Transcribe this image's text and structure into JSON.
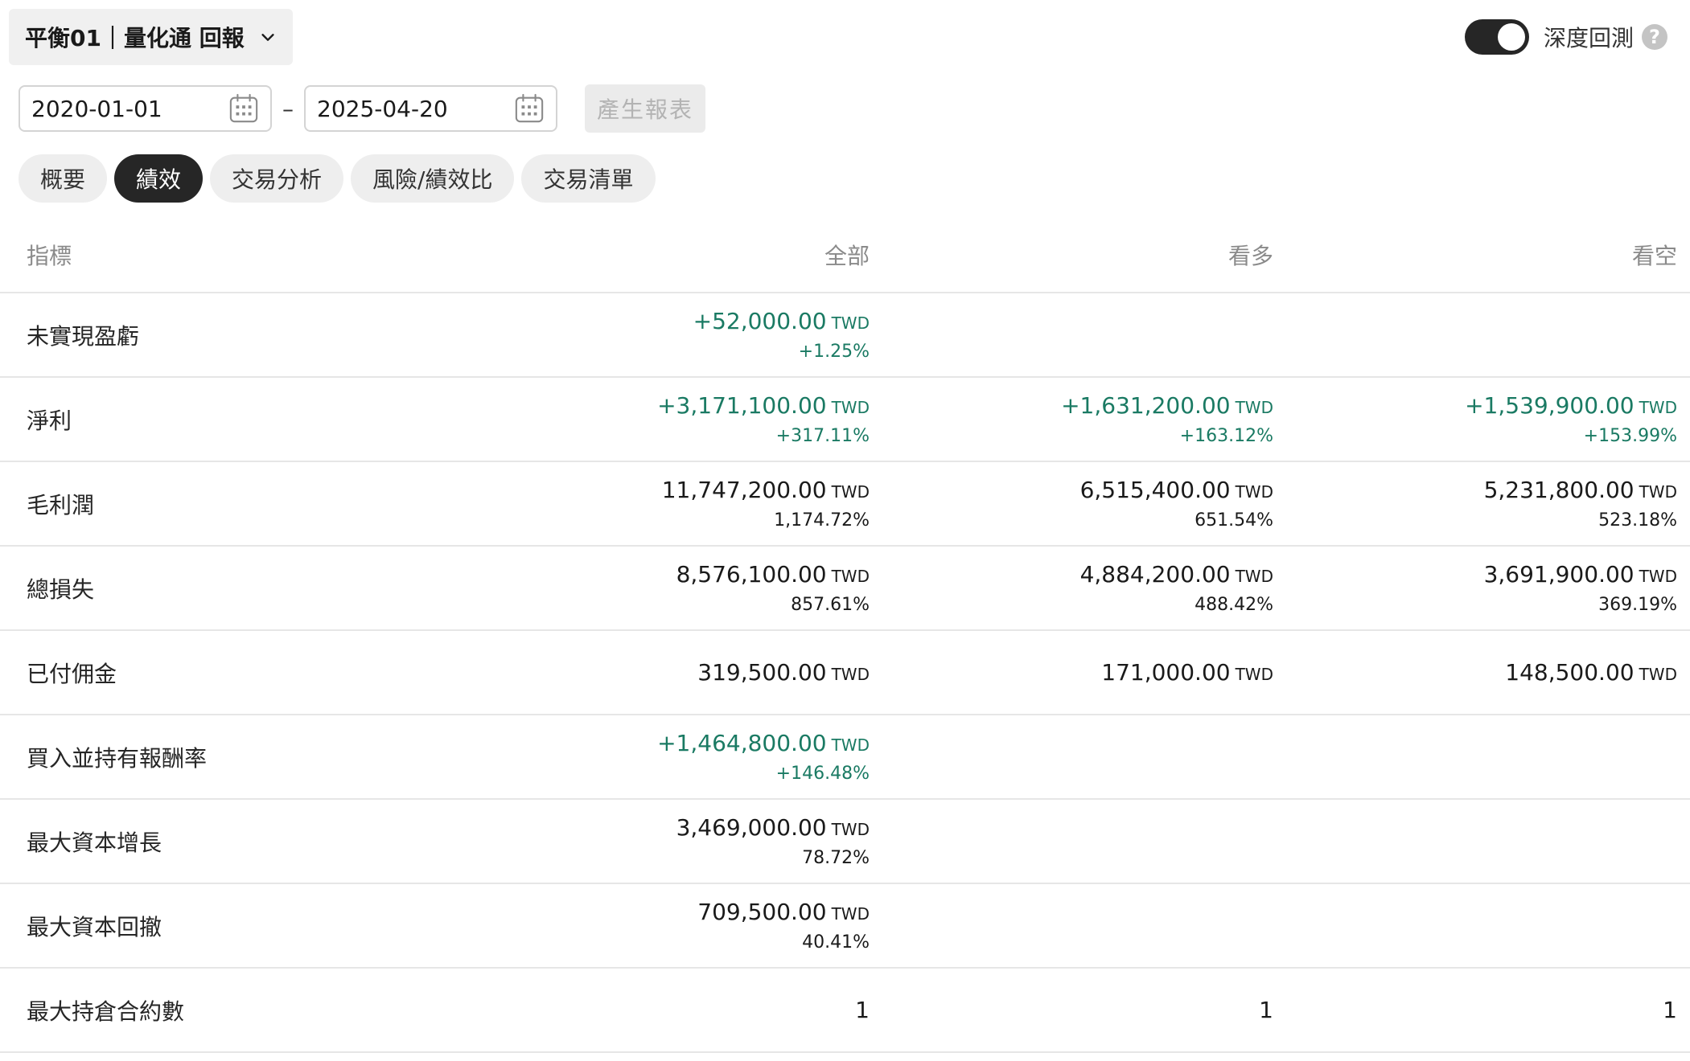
{
  "header": {
    "strategy_title": "平衡01｜量化通 回報",
    "deep_backtest_label": "深度回測",
    "deep_backtest_on": true,
    "help_glyph": "?"
  },
  "dates": {
    "start": "2020-01-01",
    "separator": "–",
    "end": "2025-04-20",
    "generate_label": "產生報表"
  },
  "tabs": [
    {
      "label": "概要",
      "active": false
    },
    {
      "label": "績效",
      "active": true
    },
    {
      "label": "交易分析",
      "active": false
    },
    {
      "label": "風險/績效比",
      "active": false
    },
    {
      "label": "交易清單",
      "active": false
    }
  ],
  "table": {
    "headers": {
      "metric": "指標",
      "all": "全部",
      "long": "看多",
      "short": "看空"
    },
    "rows": [
      {
        "label": "未實現盈虧",
        "all": {
          "amount": "+52,000.00",
          "unit": "TWD",
          "pct": "+1.25%",
          "positive": true
        },
        "long": null,
        "short": null
      },
      {
        "label": "淨利",
        "all": {
          "amount": "+3,171,100.00",
          "unit": "TWD",
          "pct": "+317.11%",
          "positive": true
        },
        "long": {
          "amount": "+1,631,200.00",
          "unit": "TWD",
          "pct": "+163.12%",
          "positive": true
        },
        "short": {
          "amount": "+1,539,900.00",
          "unit": "TWD",
          "pct": "+153.99%",
          "positive": true
        }
      },
      {
        "label": "毛利潤",
        "all": {
          "amount": "11,747,200.00",
          "unit": "TWD",
          "pct": "1,174.72%",
          "positive": false
        },
        "long": {
          "amount": "6,515,400.00",
          "unit": "TWD",
          "pct": "651.54%",
          "positive": false
        },
        "short": {
          "amount": "5,231,800.00",
          "unit": "TWD",
          "pct": "523.18%",
          "positive": false
        }
      },
      {
        "label": "總損失",
        "all": {
          "amount": "8,576,100.00",
          "unit": "TWD",
          "pct": "857.61%",
          "positive": false
        },
        "long": {
          "amount": "4,884,200.00",
          "unit": "TWD",
          "pct": "488.42%",
          "positive": false
        },
        "short": {
          "amount": "3,691,900.00",
          "unit": "TWD",
          "pct": "369.19%",
          "positive": false
        }
      },
      {
        "label": "已付佣金",
        "all": {
          "amount": "319,500.00",
          "unit": "TWD",
          "pct": null,
          "positive": false
        },
        "long": {
          "amount": "171,000.00",
          "unit": "TWD",
          "pct": null,
          "positive": false
        },
        "short": {
          "amount": "148,500.00",
          "unit": "TWD",
          "pct": null,
          "positive": false
        }
      },
      {
        "label": "買入並持有報酬率",
        "all": {
          "amount": "+1,464,800.00",
          "unit": "TWD",
          "pct": "+146.48%",
          "positive": true
        },
        "long": null,
        "short": null
      },
      {
        "label": "最大資本增長",
        "all": {
          "amount": "3,469,000.00",
          "unit": "TWD",
          "pct": "78.72%",
          "positive": false
        },
        "long": null,
        "short": null
      },
      {
        "label": "最大資本回撤",
        "all": {
          "amount": "709,500.00",
          "unit": "TWD",
          "pct": "40.41%",
          "positive": false
        },
        "long": null,
        "short": null
      },
      {
        "label": "最大持倉合約數",
        "all": {
          "plain": "1"
        },
        "long": {
          "plain": "1"
        },
        "short": {
          "plain": "1"
        }
      }
    ]
  },
  "colors": {
    "positive": "#1a7a63",
    "toggle_on": "#262626"
  },
  "icons": {
    "dropdown": "chevron-down-icon",
    "date": "calendar-icon",
    "help": "help-icon"
  }
}
